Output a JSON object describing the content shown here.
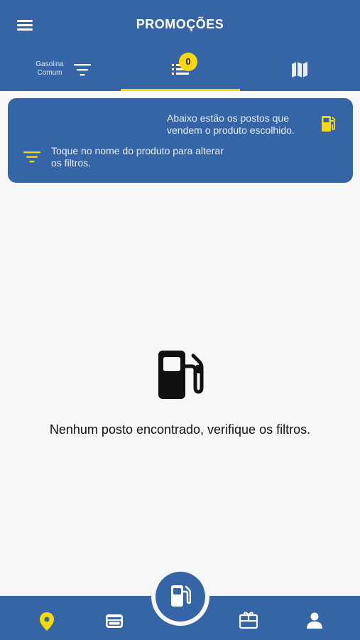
{
  "header": {
    "title": "PROMOÇÕES"
  },
  "tabs": {
    "fuel_filter_label": "Gasolina Comum",
    "list_badge_count": "0",
    "active_tab": "list"
  },
  "info_card": {
    "top_text": "Abaixo estão os postos que vendem o produto escolhido.",
    "bottom_text": "Toque no nome do produto para alterar os filtros."
  },
  "empty_state": {
    "message": "Nenhum posto encontrado, verifique os filtros."
  },
  "bottom_nav": {
    "items": [
      {
        "icon": "location-pin-icon",
        "active": true
      },
      {
        "icon": "wallet-icon",
        "active": false
      },
      {
        "icon": "fuel-pump-icon",
        "center": true
      },
      {
        "icon": "gift-card-icon",
        "active": false
      },
      {
        "icon": "person-icon",
        "active": false
      }
    ]
  },
  "colors": {
    "primary": "#3565a6",
    "accent": "#f5d90a",
    "background": "#f7f7f7"
  }
}
